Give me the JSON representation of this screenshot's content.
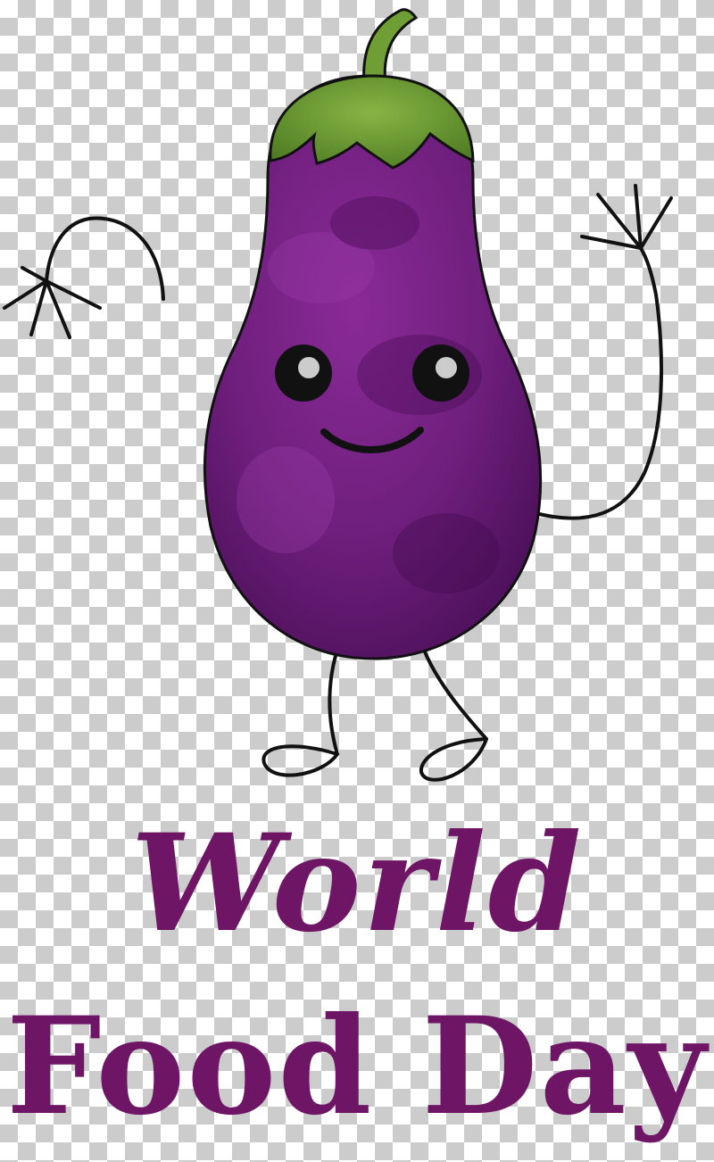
{
  "title": {
    "line1": "World",
    "line2": "Food Day"
  },
  "colors": {
    "eggplant_body": "#6f1f7d",
    "eggplant_dark": "#4a0f57",
    "stem_green": "#6f9e34",
    "outline": "#111111",
    "text_purple": "#6e1565"
  },
  "character": {
    "icon": "eggplant-character-icon"
  }
}
